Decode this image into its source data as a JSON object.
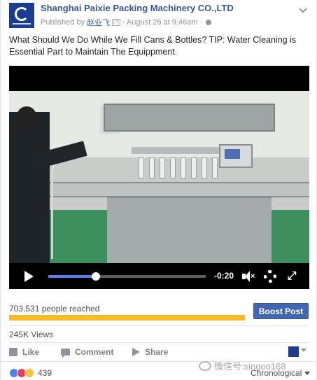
{
  "header": {
    "page_name": "Shanghai Paixie Packing Machinery CO.,LTD",
    "published_by_label": "Published by",
    "author": "赵业飞",
    "author_badge": "[?]",
    "date_time": "· August 26 at 9:46am ·"
  },
  "post": {
    "text": "What Should We Do While We Fill Cans & Bottles? TIP: Water Cleaning is Essential Part to Maintain The Equippment."
  },
  "video": {
    "time_remaining": "-0:20",
    "progress": 0.3
  },
  "stats": {
    "reach": "703,531 people reached",
    "boost_label": "Boost Post",
    "views": "245K Views"
  },
  "actions": {
    "like": "Like",
    "comment": "Comment",
    "share": "Share"
  },
  "footer": {
    "reaction_count": "439",
    "watermark": "微信号:singoo168",
    "sort_label": "Chronological"
  },
  "colors": {
    "link": "#365899",
    "boost": "#4267b2",
    "reach_bar": "#f7b928",
    "video_progress": "#4f7ef5"
  },
  "icons": [
    "page-logo",
    "chevron-down-icon",
    "globe-icon",
    "play-icon",
    "mute-icon",
    "gear-icon",
    "fullscreen-icon",
    "like-icon",
    "comment-icon",
    "share-icon",
    "wechat-icon"
  ]
}
